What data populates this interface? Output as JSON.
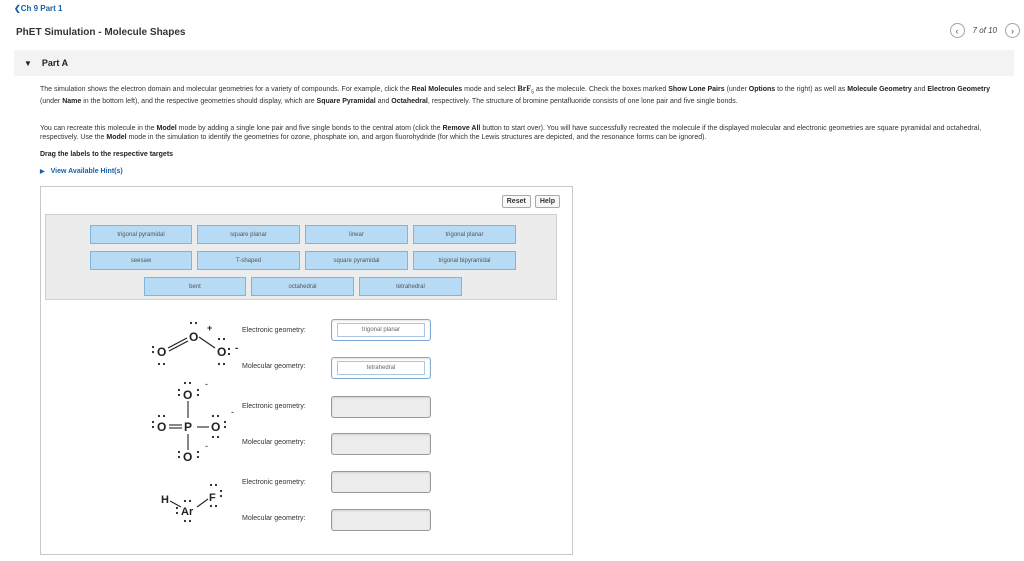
{
  "nav": {
    "back_label": "Ch 9 Part 1",
    "title": "PhET Simulation - Molecule Shapes",
    "pager_text": "7 of 10",
    "prev_icon": "chevron-left-icon",
    "next_icon": "chevron-right-icon"
  },
  "part": {
    "title": "Part A"
  },
  "instructions": {
    "p1_a": "The simulation shows the electron domain and molecular geometries for a variety of compounds. For example, click the ",
    "p1_b": "Real Molecules",
    "p1_c": " mode and select ",
    "p1_formula": "BrF",
    "p1_sub": "5",
    "p1_d": " as the molecule. Check the boxes marked ",
    "p1_e": "Show Lone Pairs",
    "p1_f": " (under ",
    "p1_g": "Options",
    "p1_h": " to the right) as well as ",
    "p1_i": "Molecule Geometry",
    "p1_j": " and ",
    "p1_k": "Electron Geometry",
    "p1_l": " (under ",
    "p1_m": "Name",
    "p1_n": " in the bottom left), and the respective geometries should display, which are ",
    "p1_o": "Square Pyramidal",
    "p1_p": " and ",
    "p1_q": "Octahedral",
    "p1_r": ", respectively. The structure of bromine pentafluoride consists of one lone pair and five single bonds.",
    "p2_a": "You can recreate this molecule in the ",
    "p2_b": "Model",
    "p2_c": " mode by adding a single lone pair and five single bonds to the central atom (click the ",
    "p2_d": "Remove All",
    "p2_e": " button to start over). You will have successfully recreated the molecule if the displayed molecular and electronic geometries are square pyramidal and octahedral, respectively. Use the ",
    "p2_f": "Model",
    "p2_g": " mode in the simulation to identify the geometries for ozone, phosphate ion, and argon fluorohydride (for which the Lewis structures are depicted, and the resonance forms can be ignored).",
    "drag": "Drag the labels to the respective targets",
    "hints": "View Available Hint(s)"
  },
  "buttons": {
    "reset": "Reset",
    "help": "Help"
  },
  "labels": [
    "trigonal pyramidal",
    "square planar",
    "linear",
    "trigonal planar",
    "seesaw",
    "T-shaped",
    "square pyramidal",
    "trigonal bipyramidal",
    "bent",
    "octahedral",
    "tetrahedral"
  ],
  "molecules": [
    {
      "name": "ozone",
      "atoms": [
        "O",
        "O",
        "O"
      ],
      "charges": [
        "+",
        "-"
      ],
      "electronic_label": "Electronic geometry:",
      "molecular_label": "Molecular geometry:",
      "electronic_value": "trigonal planar",
      "molecular_value": "tetrahedral"
    },
    {
      "name": "phosphate",
      "atoms": [
        "O",
        "O",
        "P",
        "O",
        "O"
      ],
      "charges": [
        "-",
        "-",
        "-"
      ],
      "electronic_label": "Electronic geometry:",
      "molecular_label": "Molecular geometry:",
      "electronic_value": "",
      "molecular_value": ""
    },
    {
      "name": "argon-fluorohydride",
      "atoms": [
        "H",
        "Ar",
        "F"
      ],
      "electronic_label": "Electronic geometry:",
      "molecular_label": "Molecular geometry:",
      "electronic_value": "",
      "molecular_value": ""
    }
  ]
}
